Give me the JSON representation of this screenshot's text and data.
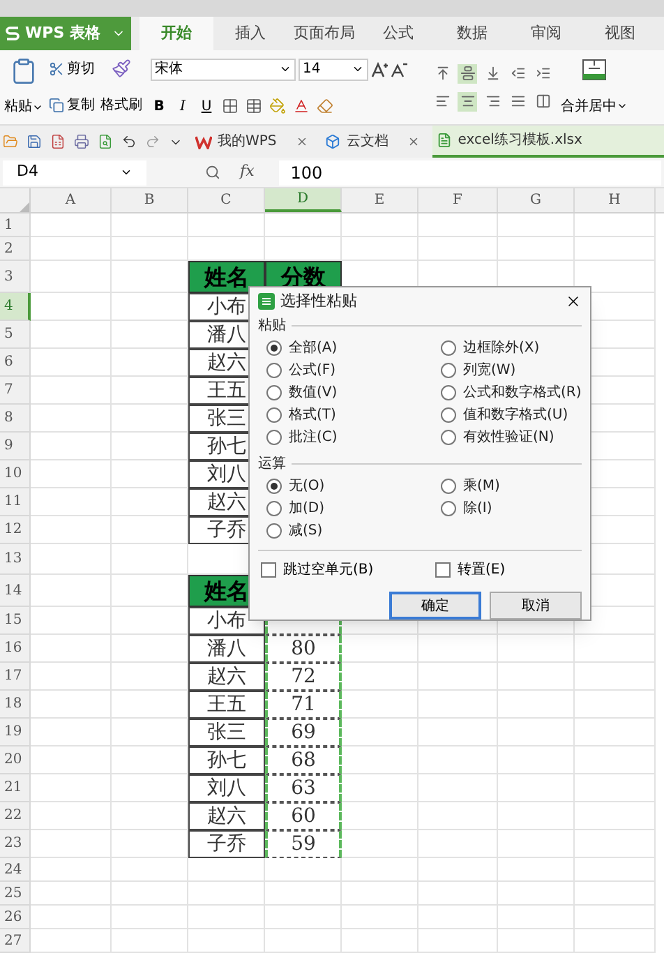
{
  "app": {
    "title": "WPS 表格"
  },
  "menu_tabs": [
    {
      "label": "开始",
      "selected": true
    },
    {
      "label": "插入",
      "selected": false
    },
    {
      "label": "页面布局",
      "selected": false
    },
    {
      "label": "公式",
      "selected": false
    },
    {
      "label": "数据",
      "selected": false
    },
    {
      "label": "审阅",
      "selected": false
    },
    {
      "label": "视图",
      "selected": false
    }
  ],
  "ribbon": {
    "paste": "粘贴",
    "cut": "剪切",
    "copy": "复制",
    "format_painter": "格式刷",
    "font": "宋体",
    "font_size": "14",
    "styles": [
      "B",
      "I",
      "U"
    ],
    "merge": "合并居中",
    "alignment": [
      {
        "selected": false
      },
      {
        "selected": true
      },
      {
        "selected": false
      },
      {
        "selected": false
      },
      {
        "selected": false
      },
      {
        "selected": false
      },
      {
        "selected": true
      },
      {
        "selected": false
      },
      {
        "selected": false
      },
      {
        "selected": false
      }
    ]
  },
  "doc_tabs": [
    {
      "label": "我的WPS",
      "selected": false,
      "closable": true
    },
    {
      "label": "云文档",
      "selected": false,
      "closable": true
    },
    {
      "label": "excel练习模板.xlsx",
      "selected": true,
      "closable": false
    }
  ],
  "formula_bar": {
    "cell_ref": "D4",
    "fx": "fx",
    "value": "100"
  },
  "sheet": {
    "columns": [
      {
        "label": "A",
        "selected": false
      },
      {
        "label": "B",
        "selected": false
      },
      {
        "label": "C",
        "selected": false
      },
      {
        "label": "D",
        "selected": true
      },
      {
        "label": "E",
        "selected": false
      },
      {
        "label": "F",
        "selected": false
      },
      {
        "label": "G",
        "selected": false
      },
      {
        "label": "H",
        "selected": false
      }
    ],
    "rows": [
      {
        "number": "1",
        "kind": "empty",
        "selected": false
      },
      {
        "number": "2",
        "kind": "empty",
        "selected": false
      },
      {
        "number": "3",
        "kind": "header",
        "selected": false,
        "name": "姓名",
        "score": "分数"
      },
      {
        "number": "4",
        "kind": "data",
        "selected": true,
        "name": "小布"
      },
      {
        "number": "5",
        "kind": "data",
        "selected": false,
        "name": "潘八"
      },
      {
        "number": "6",
        "kind": "data",
        "selected": false,
        "name": "赵六"
      },
      {
        "number": "7",
        "kind": "data",
        "selected": false,
        "name": "王五"
      },
      {
        "number": "8",
        "kind": "data",
        "selected": false,
        "name": "张三"
      },
      {
        "number": "9",
        "kind": "data",
        "selected": false,
        "name": "孙七"
      },
      {
        "number": "10",
        "kind": "data",
        "selected": false,
        "name": "刘八"
      },
      {
        "number": "11",
        "kind": "data",
        "selected": false,
        "name": "赵六"
      },
      {
        "number": "12",
        "kind": "data",
        "selected": false,
        "name": "子乔"
      },
      {
        "number": "13",
        "kind": "gap",
        "selected": false
      },
      {
        "number": "14",
        "kind": "header",
        "selected": false,
        "name": "姓名"
      },
      {
        "number": "15",
        "kind": "data",
        "selected": false,
        "name": "小布",
        "copied": true
      },
      {
        "number": "16",
        "kind": "data",
        "selected": false,
        "name": "潘八",
        "score": "80",
        "copied": true
      },
      {
        "number": "17",
        "kind": "data",
        "selected": false,
        "name": "赵六",
        "score": "72",
        "copied": true
      },
      {
        "number": "18",
        "kind": "data",
        "selected": false,
        "name": "王五",
        "score": "71",
        "copied": true
      },
      {
        "number": "19",
        "kind": "data",
        "selected": false,
        "name": "张三",
        "score": "69",
        "copied": true
      },
      {
        "number": "20",
        "kind": "data",
        "selected": false,
        "name": "孙七",
        "score": "68",
        "copied": true
      },
      {
        "number": "21",
        "kind": "data",
        "selected": false,
        "name": "刘八",
        "score": "63",
        "copied": true
      },
      {
        "number": "22",
        "kind": "data",
        "selected": false,
        "name": "赵六",
        "score": "60",
        "copied": true
      },
      {
        "number": "23",
        "kind": "data",
        "selected": false,
        "name": "子乔",
        "score": "59",
        "copied": true
      },
      {
        "number": "24",
        "kind": "empty",
        "selected": false
      },
      {
        "number": "25",
        "kind": "empty",
        "selected": false
      },
      {
        "number": "26",
        "kind": "empty",
        "selected": false
      },
      {
        "number": "27",
        "kind": "empty",
        "selected": false
      }
    ]
  },
  "dialog": {
    "title": "选择性粘贴",
    "paste_section": {
      "label": "粘贴",
      "options": [
        {
          "label": "全部(A)",
          "selected": true
        },
        {
          "label": "边框除外(X)",
          "selected": false
        },
        {
          "label": "公式(F)",
          "selected": false
        },
        {
          "label": "列宽(W)",
          "selected": false
        },
        {
          "label": "数值(V)",
          "selected": false
        },
        {
          "label": "公式和数字格式(R)",
          "selected": false
        },
        {
          "label": "格式(T)",
          "selected": false
        },
        {
          "label": "值和数字格式(U)",
          "selected": false
        },
        {
          "label": "批注(C)",
          "selected": false
        },
        {
          "label": "有效性验证(N)",
          "selected": false
        }
      ]
    },
    "operation_section": {
      "label": "运算",
      "options": [
        {
          "label": "无(O)",
          "selected": true
        },
        {
          "label": "乘(M)",
          "selected": false
        },
        {
          "label": "加(D)",
          "selected": false
        },
        {
          "label": "除(I)",
          "selected": false
        },
        {
          "label": "减(S)",
          "selected": false
        }
      ]
    },
    "checkboxes": [
      {
        "label": "跳过空单元(B)",
        "checked": false
      },
      {
        "label": "转置(E)",
        "checked": false
      }
    ],
    "buttons": [
      {
        "label": "确定",
        "kind": "primary"
      },
      {
        "label": "取消",
        "kind": "secondary"
      }
    ]
  }
}
